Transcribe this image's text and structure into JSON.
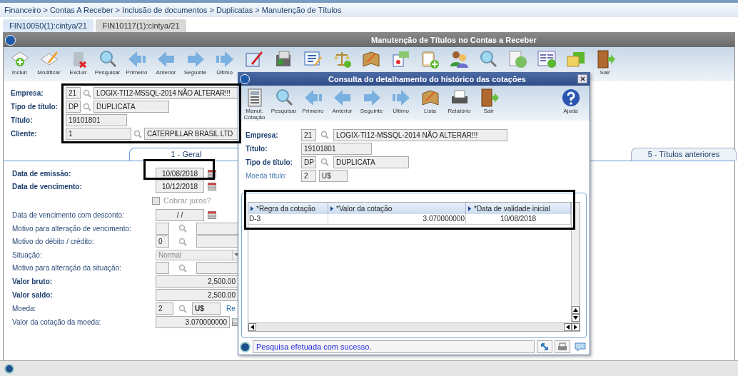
{
  "breadcrumb": "Financeiro > Contas A Receber > Inclusão de documentos > Duplicatas > Manutenção de Títulos",
  "tabs": [
    {
      "label": "FIN10050(1):cintya/21",
      "selected": true
    },
    {
      "label": "FIN10117(1):cintya/21",
      "selected": false
    }
  ],
  "window": {
    "title": "Manutenção de Títulos no Contas a Receber",
    "toolbar": [
      {
        "kind": "add",
        "label": "Incluir"
      },
      {
        "kind": "edit",
        "label": "Modificar"
      },
      {
        "kind": "delete",
        "label": "Excluir"
      },
      {
        "kind": "search",
        "label": "Pesquisar"
      },
      {
        "kind": "first",
        "label": "Primeiro"
      },
      {
        "kind": "prev",
        "label": "Anterior"
      },
      {
        "kind": "next",
        "label": "Seguinte"
      },
      {
        "kind": "last",
        "label": "Último"
      },
      {
        "kind": "sign"
      },
      {
        "kind": "money"
      },
      {
        "kind": "list"
      },
      {
        "kind": "scale"
      },
      {
        "kind": "book"
      },
      {
        "kind": "card"
      },
      {
        "kind": "clipboard"
      },
      {
        "kind": "people"
      },
      {
        "kind": "search"
      },
      {
        "kind": "dollar"
      },
      {
        "kind": "doc"
      },
      {
        "kind": "folder"
      },
      {
        "kind": "exit",
        "label": "Sair"
      }
    ]
  },
  "header_fields": [
    {
      "label": "Empresa:",
      "code": "21",
      "lookup": true,
      "description": "LOGIX-TI12-MSSQL-2014 NÃO ALTERAR!!!"
    },
    {
      "label": "Tipo de título:",
      "code": "DP",
      "lookup": true,
      "description": "DUPLICATA"
    },
    {
      "label": "Título:",
      "code": "19101801",
      "lookup": false
    },
    {
      "label": "Cliente:",
      "code": "1",
      "lookup": true,
      "description": "CATERPILLAR BRASIL LTD"
    }
  ],
  "section_tabs": [
    {
      "label": "1 - Geral",
      "selected": true
    },
    {
      "label": "5 - Títulos anteriores",
      "selected": false
    }
  ],
  "fields": [
    {
      "kind": "date",
      "label": "Data de emissão:",
      "required": true,
      "value": "10/08/2018"
    },
    {
      "kind": "date",
      "label": "Data de vencimento:",
      "required": true,
      "value": "10/12/2018"
    },
    {
      "kind": "checkbox",
      "label": "Cobrar juros?",
      "checked": false
    },
    {
      "kind": "date",
      "label": "Data de vencimento com desconto:",
      "required": false,
      "value": "/ /"
    },
    {
      "kind": "lookup",
      "label": "Motivo para alteração de vencimento:",
      "required": false
    },
    {
      "kind": "lookup",
      "label": "Motivo do débito / crédito:",
      "required": false,
      "value": "0"
    },
    {
      "kind": "select",
      "label": "Situação:",
      "required": false,
      "value": "Normal"
    },
    {
      "kind": "lookup",
      "label": "Motivo para alteração da situação:",
      "required": false
    },
    {
      "kind": "number",
      "label": "Valor bruto:",
      "required": true,
      "value": "2,500.00"
    },
    {
      "kind": "number",
      "label": "Valor saldo:",
      "required": true,
      "value": "2,500.00"
    },
    {
      "kind": "currency",
      "label": "Moeda:",
      "required": false,
      "value": "2",
      "description": "U$",
      "link": "Re"
    },
    {
      "kind": "calc",
      "label": "Valor da cotação da moeda:",
      "required": false,
      "value": "3.070000000"
    }
  ],
  "dialog": {
    "title": "Consulta do detalhamento do histórico das cotações",
    "toolbar": [
      {
        "kind": "calc",
        "label": "Manut. Cotação"
      },
      {
        "kind": "search",
        "label": "Pesquisar"
      },
      {
        "kind": "first",
        "label": "Primeiro"
      },
      {
        "kind": "prev",
        "label": "Anterior"
      },
      {
        "kind": "next",
        "label": "Seguinte"
      },
      {
        "kind": "last",
        "label": "Último"
      },
      {
        "kind": "book",
        "label": "Lista"
      },
      {
        "kind": "printer",
        "label": "Relatório"
      },
      {
        "kind": "exit",
        "label": "Sair"
      },
      {
        "kind": "help",
        "label": "Ajuda"
      }
    ],
    "fields": [
      {
        "label": "Empresa:",
        "required": true,
        "code": "21",
        "lookup": true,
        "description": "LOGIX-TI12-MSSQL-2014 NÃO ALTERAR!!!"
      },
      {
        "label": "Título:",
        "required": true,
        "code": "19101801",
        "lookup": false
      },
      {
        "label": "Tipo de título:",
        "required": true,
        "code": "DP",
        "lookup": true,
        "description": "DUPLICATA"
      },
      {
        "label": "Moeda título:",
        "required": false,
        "code": "2",
        "lookup": false,
        "description": "U$"
      }
    ],
    "table": {
      "columns": [
        "*Regra da cotação",
        "*Valor da cotação",
        "*Data de validade inicial"
      ],
      "rows": [
        [
          "D-3",
          "3.070000000",
          "10/08/2018"
        ]
      ]
    },
    "status": "Pesquisa efetuada com sucesso."
  }
}
